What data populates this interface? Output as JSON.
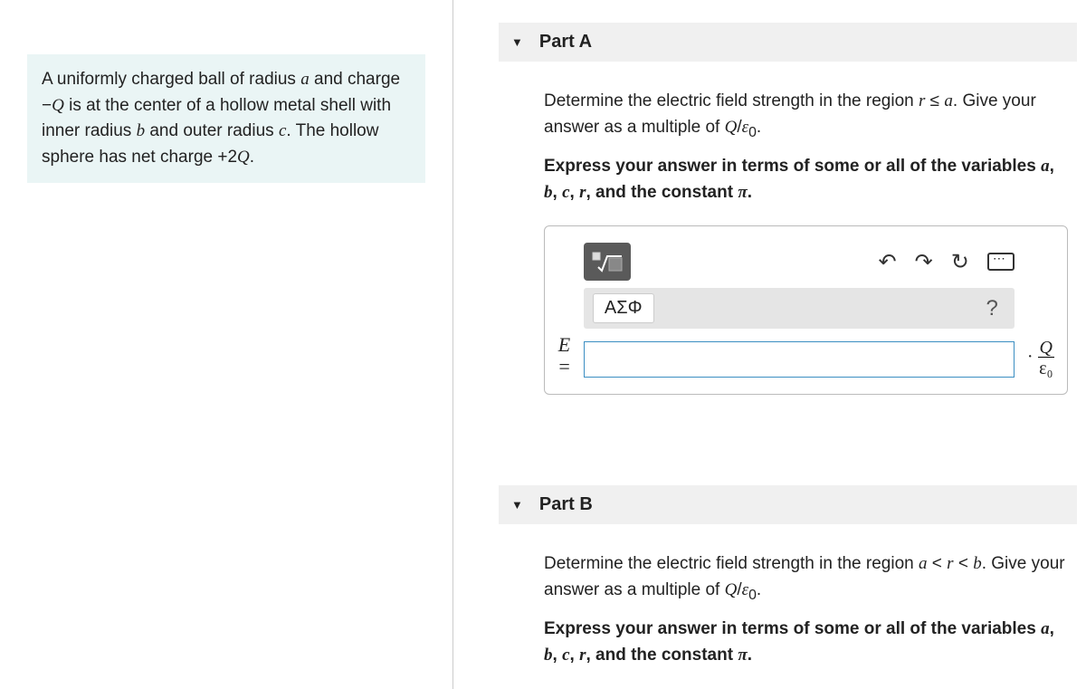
{
  "problem": {
    "text_html": "A uniformly charged ball of radius <span class='math-i'>a</span> and charge −<span class='math-i'>Q</span> is at the center of a hollow metal shell with inner radius <span class='math-i'>b</span> and outer radius <span class='math-i'>c</span>. The hollow sphere has net charge +2<span class='math-i'>Q</span>."
  },
  "partA": {
    "label": "Part A",
    "instr1_html": "Determine the electric field strength in the region <span class='math-i'>r</span> ≤ <span class='math-i'>a</span>. Give your answer as a multiple of <span class='math-i'>Q</span>/<span class='math-i'>ε</span><sub>0</sub>.",
    "instr2_html": "Express your answer in terms of some or all of the variables <span class='math-i'>a</span>, <span class='math-i'>b</span>, <span class='math-i'>c</span>, <span class='math-i'>r</span>, and the constant <span class='math-i'>π</span>.",
    "greek_label": "ΑΣΦ",
    "help_label": "?",
    "eq_lhs": "E =",
    "input_value": "",
    "unit_prefix": "·",
    "unit_top": "Q",
    "unit_bot": "ε₀"
  },
  "partB": {
    "label": "Part B",
    "instr1_html": "Determine the electric field strength in the region <span class='math-i'>a</span> &lt; <span class='math-i'>r</span> &lt; <span class='math-i'>b</span>. Give your answer as a multiple of <span class='math-i'>Q</span>/<span class='math-i'>ε</span><sub>0</sub>.",
    "instr2_html": "Express your answer in terms of some or all of the variables <span class='math-i'>a</span>, <span class='math-i'>b</span>, <span class='math-i'>c</span>, <span class='math-i'>r</span>, and the constant <span class='math-i'>π</span>."
  },
  "icons": {
    "undo": "↶",
    "redo": "↷",
    "reset": "↻"
  }
}
